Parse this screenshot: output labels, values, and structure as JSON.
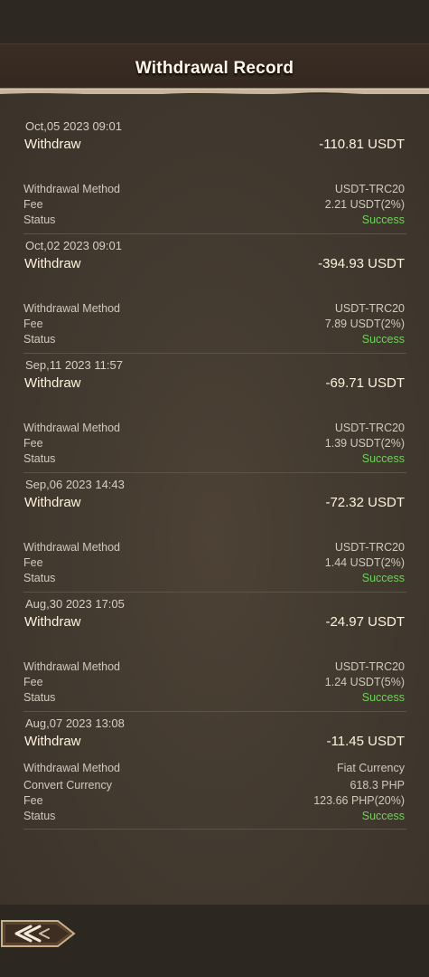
{
  "header": {
    "title": "Withdrawal Record"
  },
  "labels": {
    "method": "Withdrawal Method",
    "convert": "Convert Currency",
    "fee": "Fee",
    "status": "Status"
  },
  "records": [
    {
      "date": "Oct,05 2023 09:01",
      "type": "Withdraw",
      "amount": "-110.81 USDT",
      "method": "USDT-TRC20",
      "fee": "2.21 USDT(2%)",
      "status": "Success"
    },
    {
      "date": "Oct,02 2023 09:01",
      "type": "Withdraw",
      "amount": "-394.93 USDT",
      "method": "USDT-TRC20",
      "fee": "7.89 USDT(2%)",
      "status": "Success"
    },
    {
      "date": "Sep,11 2023 11:57",
      "type": "Withdraw",
      "amount": "-69.71 USDT",
      "method": "USDT-TRC20",
      "fee": "1.39 USDT(2%)",
      "status": "Success"
    },
    {
      "date": "Sep,06 2023 14:43",
      "type": "Withdraw",
      "amount": "-72.32 USDT",
      "method": "USDT-TRC20",
      "fee": "1.44 USDT(2%)",
      "status": "Success"
    },
    {
      "date": "Aug,30 2023 17:05",
      "type": "Withdraw",
      "amount": "-24.97 USDT",
      "method": "USDT-TRC20",
      "fee": "1.24 USDT(5%)",
      "status": "Success"
    },
    {
      "date": "Aug,07 2023 13:08",
      "type": "Withdraw",
      "amount": "-11.45 USDT",
      "method": "Fiat Currency",
      "convert": "618.3 PHP",
      "fee": "123.66 PHP(20%)",
      "status": "Success"
    }
  ],
  "colors": {
    "status_success": "#6fd15a",
    "title_text": "#fff7ea",
    "background": "#433a30"
  },
  "icons": {
    "back": "double-chevron-left-icon"
  }
}
